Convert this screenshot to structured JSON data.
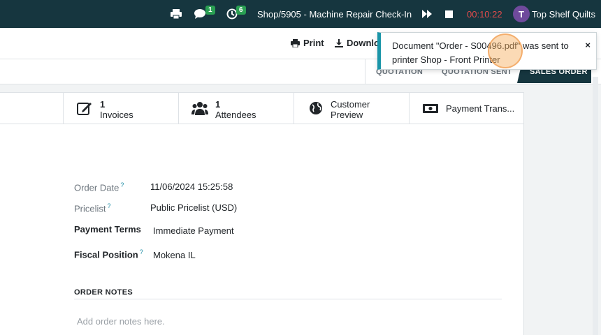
{
  "navbar": {
    "chat_badge": "1",
    "activity_badge": "6",
    "session_title": "Shop/5905 - Machine Repair Check-In",
    "timer": "00:10:22",
    "avatar_letter": "T",
    "company": "Top Shelf Quilts"
  },
  "actions": {
    "print_label": "Print",
    "download_label": "Downlo"
  },
  "statusbar": {
    "stages": [
      "QUOTATION",
      "QUOTATION SENT",
      "SALES ORDER"
    ],
    "active_stage": "SALES ORDER"
  },
  "smart_buttons": [
    {
      "icon": "invoice-icon",
      "count": "1",
      "label": "Invoices"
    },
    {
      "icon": "attendees-icon",
      "count": "1",
      "label": "Attendees"
    },
    {
      "icon": "globe-icon",
      "line1": "Customer",
      "line2": "Preview"
    },
    {
      "icon": "money-icon",
      "label": "Payment Trans..."
    }
  ],
  "fields": {
    "order_date_label": "Order Date",
    "order_date_value": "11/06/2024 15:25:58",
    "pricelist_label": "Pricelist",
    "pricelist_value": "Public Pricelist (USD)",
    "payment_terms_label": "Payment Terms",
    "payment_terms_value": "Immediate Payment",
    "fiscal_position_label": "Fiscal Position",
    "fiscal_position_value": "Mokena IL",
    "help_mark": "?"
  },
  "notes": {
    "title": "ORDER NOTES",
    "placeholder": "Add order notes here."
  },
  "toast": {
    "message": "Document \"Order - S00496.pdf\" was sent to printer Shop - Front Printer",
    "close": "×"
  },
  "colors": {
    "navbar": "#16363f",
    "accent": "#1a95a8",
    "badge": "#2aa053",
    "timer": "#e24b4b",
    "avatar": "#6f4a9c"
  }
}
